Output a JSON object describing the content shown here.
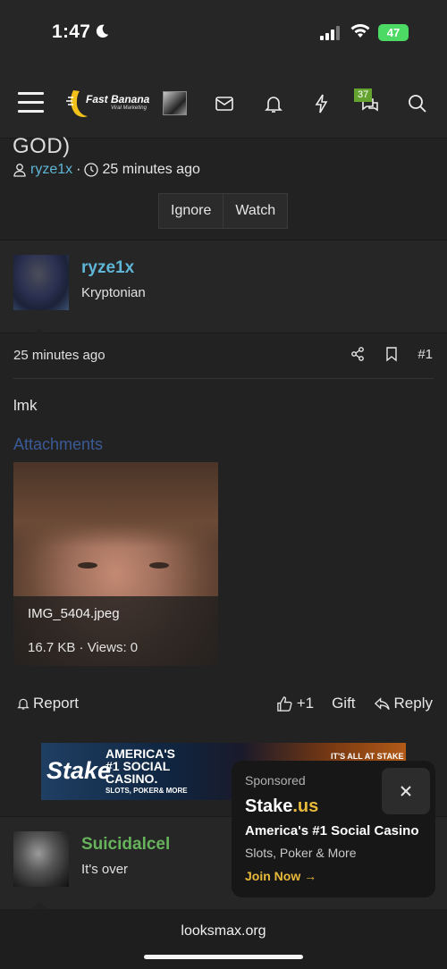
{
  "status_bar": {
    "time": "1:47",
    "battery": "47"
  },
  "navbar": {
    "logo_text": "Fast Banana",
    "logo_tagline": "Viral Marketing",
    "badge_count": "37"
  },
  "thread": {
    "title_fragment": "GOD)",
    "author": "ryze1x",
    "separator": "·",
    "time": "25 minutes ago",
    "ignore_label": "Ignore",
    "watch_label": "Watch"
  },
  "post": {
    "author": "ryze1x",
    "user_title": "Kryptonian",
    "time": "25 minutes ago",
    "number": "#1",
    "body": "lmk",
    "attachments_label": "Attachments",
    "attachment": {
      "filename": "IMG_5404.jpeg",
      "info": "16.7 KB · Views: 0"
    },
    "report_label": "Report",
    "like_label": "+1",
    "gift_label": "Gift",
    "reply_label": "Reply"
  },
  "ad_banner": {
    "brand": "Stake",
    "slogan_line1": "AMERICA'S",
    "slogan_line2": "#1 SOCIAL",
    "slogan_line3": "CASINO.",
    "sub": "SLOTS, POKER& MORE",
    "right_text": "IT'S ALL AT STAKE"
  },
  "post2": {
    "author": "Suicidalcel",
    "user_title": "It's over"
  },
  "sponsored": {
    "label": "Sponsored",
    "brand": "Stake",
    "brand_tld": ".us",
    "headline": "America's #1 Social Casino",
    "desc": "Slots, Poker & More",
    "cta": "Join Now →"
  },
  "urlbar": {
    "url": "looksmax.org"
  },
  "colors": {
    "background": "#222222",
    "username_blue": "#5fb6d6",
    "username_green": "#67b35c",
    "badge_green": "#65a330",
    "stake_gold": "#e8b93a",
    "attachments_blue": "#3b5a96"
  }
}
